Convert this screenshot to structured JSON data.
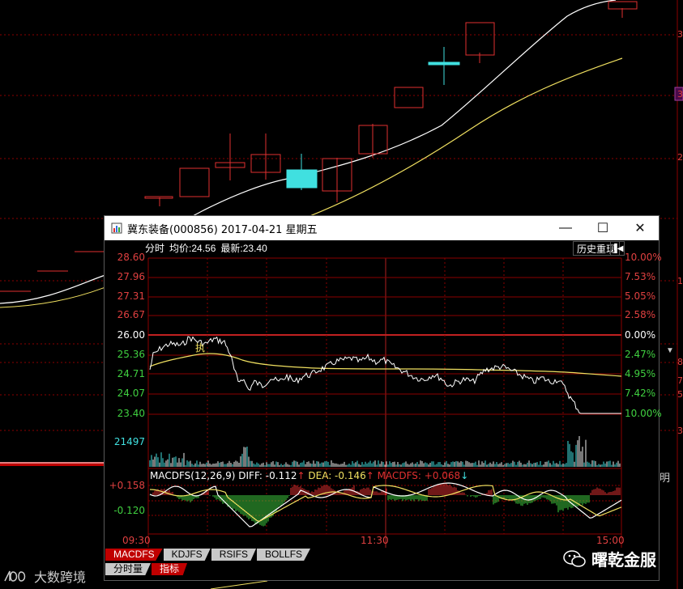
{
  "popup": {
    "title": "冀东装备(000856) 2017-04-21 星期五",
    "controls": {
      "minimize": "—",
      "maximize": "☐",
      "close": "✕"
    }
  },
  "infobar": {
    "mode": "分时",
    "avg_label": "均价:",
    "avg_value": "24.56",
    "last_label": "最新:",
    "last_value": "23.40"
  },
  "history_button": "历史重现",
  "price_axis_left": [
    "28.60",
    "27.96",
    "27.31",
    "26.67",
    "26.00",
    "25.36",
    "24.71",
    "24.07",
    "23.40"
  ],
  "pct_axis_right": [
    "10.00%",
    "7.53%",
    "5.05%",
    "2.58%",
    "0.00%",
    "2.47%",
    "4.95%",
    "7.42%",
    "10.00%"
  ],
  "volume_label": "21497",
  "macd_axis": [
    "+0.158",
    "-0.120"
  ],
  "macd_info": {
    "name": "MACDFS(12,26,9)",
    "diff": "DIFF: -0.112",
    "diff_arrow": "↑",
    "dea": "DEA: -0.146",
    "dea_arrow": "↑",
    "macd": "MACDFS: +0.068",
    "macd_arrow": "↓"
  },
  "time_axis": [
    "09:30",
    "11:30",
    "15:00"
  ],
  "annotation": "执",
  "tabs_row1": [
    "MACDFS",
    "KDJFS",
    "RSIFS",
    "BOLLFS"
  ],
  "tabs_row2": [
    "分时量",
    "指标"
  ],
  "watermark_left": "大数跨境",
  "watermark_right": "曙乾金服",
  "bg_right_label": "明",
  "bg_axis_labels": [
    "3",
    "3",
    "2",
    "1",
    "8",
    "7",
    "5",
    "3"
  ],
  "colors": {
    "up": "#e03030",
    "down": "#40e0e0",
    "price_line": "#ffffff",
    "avg_line": "#f0e060",
    "grid": "#8b0000"
  }
}
